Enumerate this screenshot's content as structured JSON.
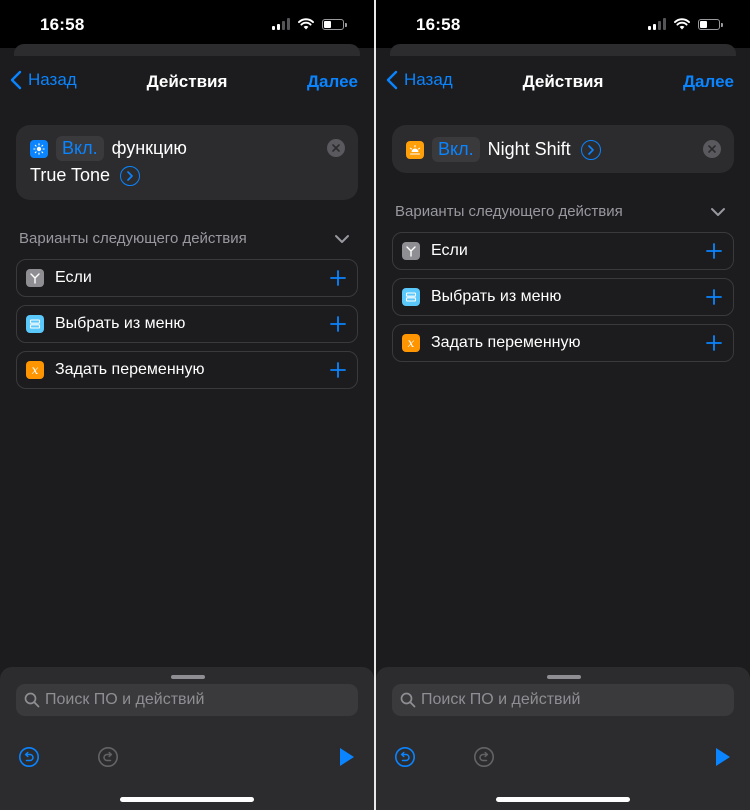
{
  "status_bar": {
    "time": "16:58"
  },
  "nav": {
    "back_label": "Назад",
    "title": "Действия",
    "next_label": "Далее"
  },
  "section_title": "Варианты следующего действия",
  "suggestions": [
    {
      "label": "Если",
      "icon": "if-icon",
      "color": "#8e8e93"
    },
    {
      "label": "Выбрать из меню",
      "icon": "menu-icon",
      "color": "#5ac8fa"
    },
    {
      "label": "Задать переменную",
      "icon": "variable-icon",
      "color": "#ff9500"
    }
  ],
  "search": {
    "placeholder": "Поиск ПО и действий"
  },
  "left": {
    "action": {
      "token": "Вкл.",
      "text_line1": "функцию",
      "text_line2": "True Tone",
      "icon": "brightness-icon",
      "icon_color": "#0a84ff"
    }
  },
  "right": {
    "action": {
      "token": "Вкл.",
      "text": "Night Shift",
      "icon": "night-shift-icon",
      "icon_color": "#ff9f0a"
    }
  },
  "colors": {
    "accent": "#0a84ff",
    "background": "#1c1c1e",
    "card": "#2c2c2e",
    "secondary_text": "#98989f"
  }
}
